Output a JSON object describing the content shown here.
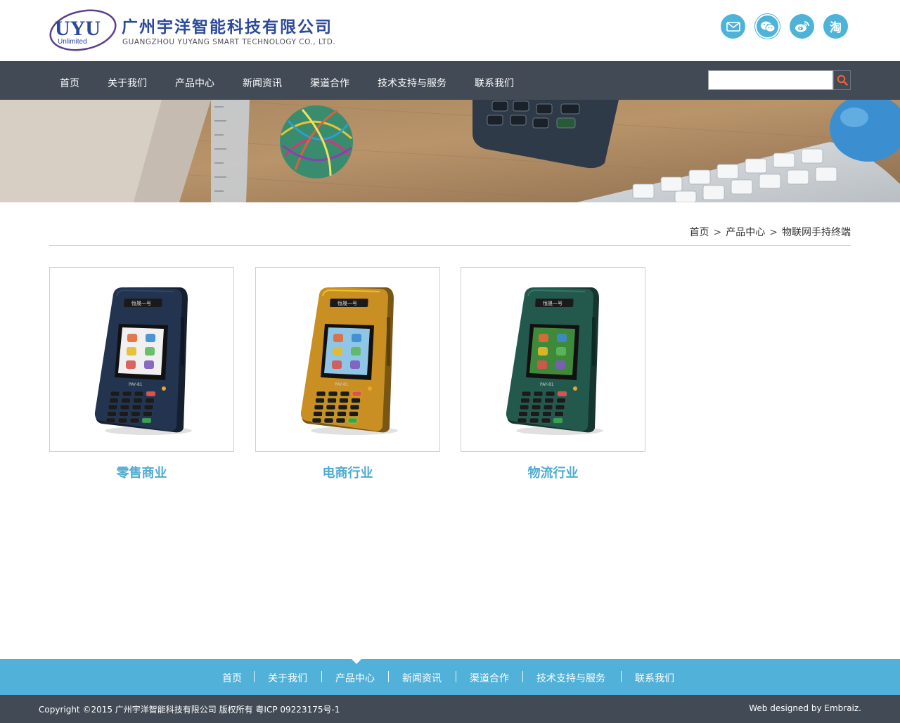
{
  "header": {
    "logo_text": "UYU",
    "logo_sub": "Unlimited",
    "company_cn": "广州宇洋智能科技有限公司",
    "company_en": "GUANGZHOU YUYANG SMART TECHNOLOGY CO., LTD.",
    "social_icons": [
      "mail-icon",
      "wechat-icon",
      "weibo-icon",
      "taobao-icon"
    ],
    "taobao_glyph": "淘"
  },
  "nav": {
    "items": [
      "首页",
      "关于我们",
      "产品中心",
      "新闻资讯",
      "渠道合作",
      "技术支持与服务",
      "联系我们"
    ],
    "search_value": ""
  },
  "breadcrumb": {
    "items": [
      "首页",
      "产品中心",
      "物联网手持终端"
    ],
    "separator": ">"
  },
  "products": [
    {
      "title": "零售商业",
      "device_color": "#22344f",
      "device_label": "PAY-81",
      "top_label": "恒晟一号"
    },
    {
      "title": "电商行业",
      "device_color": "#c98f22",
      "device_label": "PAY-81",
      "top_label": "恒晟一号"
    },
    {
      "title": "物流行业",
      "device_color": "#23594c",
      "device_label": "PAY-81",
      "top_label": "恒晟一号"
    }
  ],
  "footer_nav": {
    "items": [
      "首页",
      "关于我们",
      "产品中心",
      "新闻资讯",
      "渠道合作",
      "技术支持与服务",
      "联系我们"
    ],
    "active": "产品中心"
  },
  "bottom": {
    "copyright": "Copyright ©2015 广州宇洋智能科技有限公司 版权所有 粤ICP 09223175号-1",
    "credit": "Web designed by Embraiz."
  },
  "colors": {
    "brand_blue": "#2b4a9c",
    "accent": "#4eb3d8",
    "nav_bg": "#414a55",
    "search_icon": "#e8613a"
  }
}
